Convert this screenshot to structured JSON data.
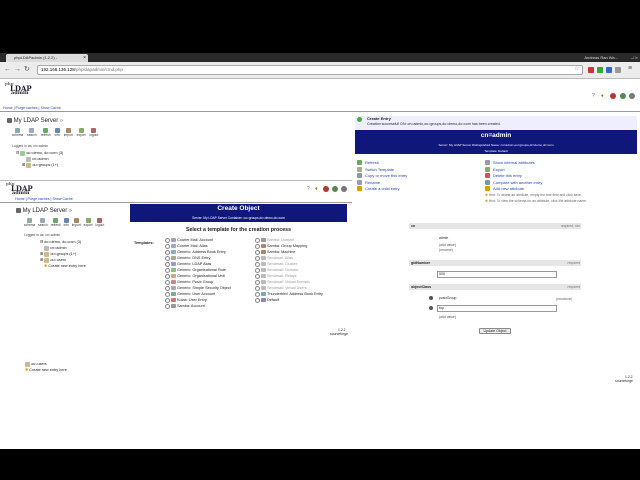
{
  "browser": {
    "tab_title": "phpLDAPadmin (1.2.2) - ",
    "user": "Andreas Ran Wa...",
    "url_host": "192.168.136.128",
    "url_path": "/phpldapadmin/cmd.php"
  },
  "app": {
    "logo_top": "php",
    "logo_mid": "LDAP",
    "logo_bot": "admin",
    "top_links": [
      "Home",
      "Purge caches",
      "Show Cache"
    ],
    "version": "1.2.2",
    "sourceforge": "sourceforge"
  },
  "server_panel": {
    "server_name": "My LDAP Server",
    "controls": [
      "schema",
      "search",
      "refresh",
      "info",
      "import",
      "export",
      "logout"
    ],
    "logged_in_as": "Logged in as: cn=admin",
    "tree": [
      {
        "label": "dc=demo, dc=com (3)"
      },
      {
        "label": "cn=admin"
      },
      {
        "label": "ou=groups (1+)"
      }
    ]
  },
  "inner_frame": {
    "top_links": [
      "Home",
      "Purge caches",
      "Show Cache"
    ],
    "server_name": "My LDAP Server",
    "controls": [
      "schema",
      "search",
      "refresh",
      "info",
      "import",
      "export",
      "logout"
    ],
    "logged_in_as": "Logged in as: cn=admin",
    "tree": [
      {
        "label": "dc=demo, dc=com (3)"
      },
      {
        "label": "cn=admin"
      },
      {
        "label": "ou=groups (1+)"
      },
      {
        "label": "ou=users"
      },
      {
        "label": "Create new entry here"
      }
    ],
    "bottom_tree": [
      {
        "label": "ou=users"
      },
      {
        "label": "Create new entry here"
      }
    ],
    "create_title": "Create Object",
    "create_sub": "Server: My LDAP Server   Container: ou=groups,dc=demo,dc=com",
    "select_template": "Select a template for the creation process",
    "templates_label": "Templates:",
    "templates_left": [
      {
        "label": "Courier Mail: Account",
        "disabled": false
      },
      {
        "label": "Courier Mail: Alias",
        "disabled": false
      },
      {
        "label": "Generic: Address Book Entry",
        "disabled": false
      },
      {
        "label": "Generic: DNS Entry",
        "disabled": false
      },
      {
        "label": "Generic: LDAP Alias",
        "disabled": false
      },
      {
        "label": "Generic: Organisational Role",
        "disabled": false
      },
      {
        "label": "Generic: Organisational Unit",
        "disabled": false
      },
      {
        "label": "Generic: Posix Group",
        "disabled": false
      },
      {
        "label": "Generic: Simple Security Object",
        "disabled": false
      },
      {
        "label": "Generic: User Account",
        "disabled": false
      },
      {
        "label": "Kolab: User Entry",
        "disabled": false
      },
      {
        "label": "Samba: Account",
        "disabled": false
      }
    ],
    "templates_right": [
      {
        "label": "Samba: Domain",
        "disabled": true
      },
      {
        "label": "Samba: Group Mapping",
        "disabled": false
      },
      {
        "label": "Samba: Machine",
        "disabled": false
      },
      {
        "label": "Sendmail: Alias",
        "disabled": true
      },
      {
        "label": "Sendmail: Cluster",
        "disabled": true
      },
      {
        "label": "Sendmail: Domain",
        "disabled": true
      },
      {
        "label": "Sendmail: Relays",
        "disabled": true
      },
      {
        "label": "Sendmail: Virtual Domain",
        "disabled": true
      },
      {
        "label": "Sendmail: Virtual Users",
        "disabled": true
      },
      {
        "label": "Thunderbird: Address Book Entry",
        "disabled": false
      },
      {
        "label": "Default",
        "disabled": false
      }
    ]
  },
  "right_panel": {
    "notice_title": "Create Entry",
    "notice_text": "Creation successful! DN: cn=admin,ou=groups,dc=demo,dc=com has been created.",
    "entry_title": "cn=admin",
    "entry_sub": "Server: My LDAP Server   Distinguished Name: cn=admin,ou=groups,dc=demo,dc=com",
    "entry_sub2": "Template: Default",
    "actions_left": [
      "Refresh",
      "Switch Template",
      "Copy or move this entry",
      "Rename",
      "Create a child entry"
    ],
    "actions_right": [
      "Show internal attributes",
      "Export",
      "Delete this entry",
      "Compare with another entry",
      "Add new attribute"
    ],
    "hint1": "Hint: To delete an attribute, empty the text field and click save.",
    "hint2": "Hint: To view the schema for an attribute, click the attribute name.",
    "attrs": [
      {
        "name": "cn",
        "tag": "required, rdn",
        "value": "admin",
        "note1": "(add value)",
        "note2": "(rename)"
      },
      {
        "name": "gidNumber",
        "tag": "required",
        "value": "500",
        "note1": "",
        "note2": ""
      },
      {
        "name": "objectClass",
        "tag": "required",
        "value": "posixGroup",
        "value2": "top",
        "structural": "(structural)",
        "note1": "(add value)",
        "note2": ""
      }
    ],
    "update_button": "Update Object"
  }
}
